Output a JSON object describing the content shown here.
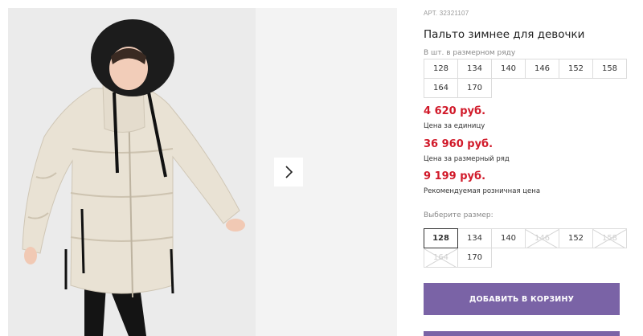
{
  "gallery": {
    "next_icon": "chevron-right-icon"
  },
  "product": {
    "article": "АРТ. 32321107",
    "title": "Пальто зимнее для девочки"
  },
  "size_row": {
    "caption": "В шт. в размерном ряду",
    "sizes": [
      "128",
      "134",
      "140",
      "146",
      "152",
      "158",
      "164",
      "170"
    ]
  },
  "prices": {
    "unit_price": "4 620 руб.",
    "unit_label": "Цена за единицу",
    "row_price": "36 960 руб.",
    "row_label": "Цена за размерный ряд",
    "retail_price": "9 199 руб.",
    "retail_label": "Рекомендуемая розничная цена"
  },
  "size_picker": {
    "caption": "Выберите размер:",
    "selected": "128",
    "sizes": [
      {
        "label": "128",
        "state": "selected"
      },
      {
        "label": "134",
        "state": "available"
      },
      {
        "label": "140",
        "state": "available"
      },
      {
        "label": "146",
        "state": "unavailable"
      },
      {
        "label": "152",
        "state": "available"
      },
      {
        "label": "158",
        "state": "unavailable"
      },
      {
        "label": "164",
        "state": "unavailable"
      },
      {
        "label": "170",
        "state": "available"
      }
    ]
  },
  "actions": {
    "add_to_cart": "ДОБАВИТЬ В КОРЗИНУ"
  },
  "colors": {
    "accent": "#7a63a6",
    "price": "#d11a2a",
    "jacket": "#e9e1d3",
    "fur": "#1c1c1c"
  }
}
